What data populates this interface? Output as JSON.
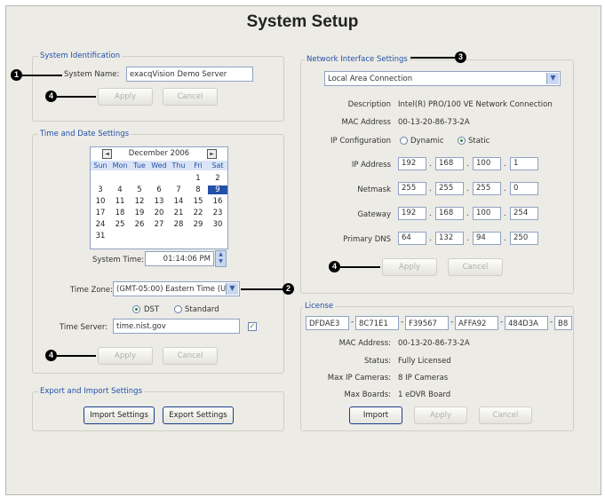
{
  "title": "System Setup",
  "sysid": {
    "legend": "System Identification",
    "name_label": "System Name:",
    "name_value": "exacqVision Demo Server",
    "apply": "Apply",
    "cancel": "Cancel"
  },
  "timedate": {
    "legend": "Time and Date Settings",
    "month": "December 2006",
    "days": [
      "Sun",
      "Mon",
      "Tue",
      "Wed",
      "Thu",
      "Fri",
      "Sat"
    ],
    "weeks": [
      [
        "",
        "",
        "",
        "",
        "",
        "1",
        "2"
      ],
      [
        "3",
        "4",
        "5",
        "6",
        "7",
        "8",
        "9"
      ],
      [
        "10",
        "11",
        "12",
        "13",
        "14",
        "15",
        "16"
      ],
      [
        "17",
        "18",
        "19",
        "20",
        "21",
        "22",
        "23"
      ],
      [
        "24",
        "25",
        "26",
        "27",
        "28",
        "29",
        "30"
      ],
      [
        "31",
        "",
        "",
        "",
        "",
        "",
        ""
      ]
    ],
    "selected_day": "9",
    "time_label": "System Time:",
    "time_value": "01:14:06 PM",
    "zone_label": "Time Zone:",
    "zone_value": "(GMT-05:00) Eastern Time (U",
    "dst": "DST",
    "standard": "Standard",
    "server_label": "Time Server:",
    "server_value": "time.nist.gov",
    "apply": "Apply",
    "cancel": "Cancel"
  },
  "export": {
    "legend": "Export and Import Settings",
    "import": "Import Settings",
    "export": "Export Settings"
  },
  "network": {
    "legend": "Network Interface Settings",
    "adapter": "Local Area Connection",
    "desc_label": "Description",
    "desc_value": "Intel(R) PRO/100 VE Network Connection",
    "mac_label": "MAC Address",
    "mac_value": "00-13-20-86-73-2A",
    "ipconf_label": "IP Configuration",
    "dynamic": "Dynamic",
    "static": "Static",
    "ip_label": "IP Address",
    "ip": [
      "192",
      "168",
      "100",
      "1"
    ],
    "mask_label": "Netmask",
    "mask": [
      "255",
      "255",
      "255",
      "0"
    ],
    "gw_label": "Gateway",
    "gw": [
      "192",
      "168",
      "100",
      "254"
    ],
    "dns_label": "Primary DNS",
    "dns": [
      "64",
      "132",
      "94",
      "250"
    ],
    "apply": "Apply",
    "cancel": "Cancel"
  },
  "license": {
    "legend": "License",
    "keys": [
      "DFDAE3",
      "8C71E1",
      "F39567",
      "AFFA92",
      "484D3A",
      "B8"
    ],
    "mac_label": "MAC Address:",
    "mac_value": "00-13-20-86-73-2A",
    "status_label": "Status:",
    "status_value": "Fully Licensed",
    "cams_label": "Max IP Cameras:",
    "cams_value": "8 IP Cameras",
    "boards_label": "Max Boards:",
    "boards_value": "1 eDVR Board",
    "import": "Import",
    "apply": "Apply",
    "cancel": "Cancel"
  },
  "markers": {
    "m1": "1",
    "m2": "2",
    "m3": "3",
    "m4": "4"
  }
}
